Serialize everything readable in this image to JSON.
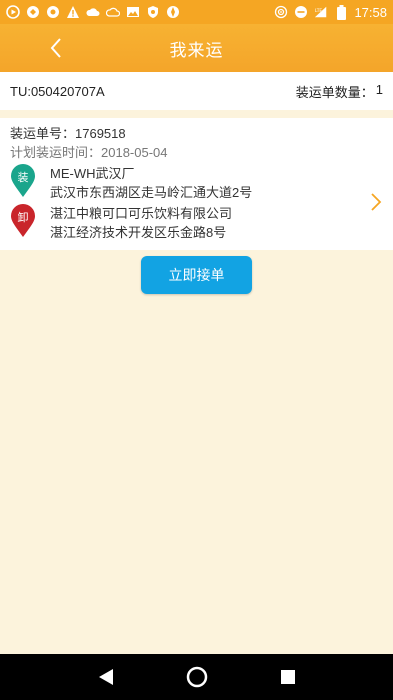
{
  "status_bar": {
    "time": "17:58",
    "icons": [
      "play-icon",
      "speed-icon",
      "chat-icon",
      "warning-icon",
      "cloud-icon",
      "cloud-outline-icon",
      "image-icon",
      "shield-icon",
      "compass-icon",
      "hotspot-icon",
      "minus-circle-icon",
      "signal-icon",
      "battery-icon"
    ],
    "network_label": "LTE"
  },
  "app_bar": {
    "title": "我来运"
  },
  "tu_row": {
    "tu_number": "TU:050420707A",
    "count_label": "装运单数量：",
    "count_value": "1"
  },
  "order": {
    "order_no": "装运单号：1769518",
    "plan_date": "计划装运时间：2018-05-04",
    "load": {
      "badge": "装",
      "name": "ME-WH武汉厂",
      "address": "武汉市东西湖区走马岭汇通大道2号",
      "color": "#1aa58c"
    },
    "unload": {
      "badge": "卸",
      "name": "湛江中粮可口可乐饮料有限公司",
      "address": "湛江经济技术开发区乐金路8号",
      "color": "#c9252b"
    }
  },
  "actions": {
    "accept_label": "立即接单"
  },
  "colors": {
    "accent": "#f5a623",
    "button": "#12a3e3",
    "background": "#fcf3dc"
  }
}
